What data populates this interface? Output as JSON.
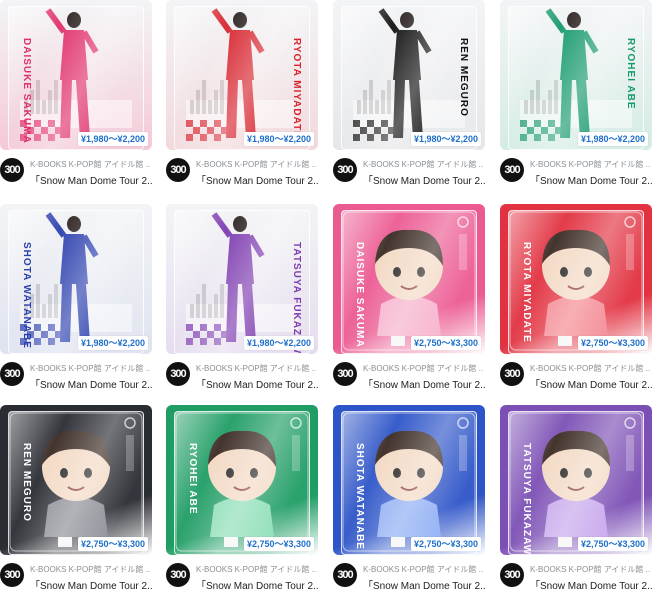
{
  "items": [
    {
      "price": "¥1,980～¥2,200",
      "avatar": "300",
      "shop": "K-BOOKS K-POP館 アイドル館 ...",
      "title": "「Snow Man Dome Tour 2...",
      "name_text": "DAISUKE SAKUMA",
      "bg": "#f4c9d6",
      "accent": "#e0306a",
      "kind": "acrylic"
    },
    {
      "price": "¥1,980～¥2,200",
      "avatar": "300",
      "shop": "K-BOOKS K-POP館 アイドル館 ...",
      "title": "「Snow Man Dome Tour 2...",
      "name_text": "RYOTA MIYADATE",
      "bg": "#f2d9dc",
      "accent": "#d8242f",
      "kind": "acrylic"
    },
    {
      "price": "¥1,980～¥2,200",
      "avatar": "300",
      "shop": "K-BOOKS K-POP館 アイドル館 ...",
      "title": "「Snow Man Dome Tour 2...",
      "name_text": "REN MEGURO",
      "bg": "#e6e7ea",
      "accent": "#111111",
      "kind": "acrylic"
    },
    {
      "price": "¥1,980～¥2,200",
      "avatar": "300",
      "shop": "K-BOOKS K-POP館 アイドル館 ...",
      "title": "「Snow Man Dome Tour 2...",
      "name_text": "RYOHEI ABE",
      "bg": "#d4ece4",
      "accent": "#169a6c",
      "kind": "acrylic"
    },
    {
      "price": "¥1,980～¥2,200",
      "avatar": "300",
      "shop": "K-BOOKS K-POP館 アイドル館 ...",
      "title": "「Snow Man Dome Tour 2...",
      "name_text": "SHOTA WATANABE",
      "bg": "#dfe3f0",
      "accent": "#2b3fae",
      "kind": "acrylic"
    },
    {
      "price": "¥1,980～¥2,200",
      "avatar": "300",
      "shop": "K-BOOKS K-POP館 アイドル館 ...",
      "title": "「Snow Man Dome Tour 2...",
      "name_text": "TATSUYA FUKAZAWA",
      "bg": "#e6ddef",
      "accent": "#7d3bb0",
      "kind": "acrylic"
    },
    {
      "price": "¥2,750～¥3,300",
      "avatar": "300",
      "shop": "K-BOOKS K-POP館 アイドル館 ...",
      "title": "「Snow Man Dome Tour 2...",
      "name_text": "DAISUKE SAKUMA",
      "bg": "#ec5a92",
      "accent": "#f7b2cc",
      "kind": "figure"
    },
    {
      "price": "¥2,750～¥3,300",
      "avatar": "300",
      "shop": "K-BOOKS K-POP館 アイドル館 ...",
      "title": "「Snow Man Dome Tour 2...",
      "name_text": "RYOTA MIYADATE",
      "bg": "#e23140",
      "accent": "#f48a93",
      "kind": "figure"
    },
    {
      "price": "¥2,750～¥3,300",
      "avatar": "300",
      "shop": "K-BOOKS K-POP館 アイドル館 ...",
      "title": "「Snow Man Dome Tour 2...",
      "name_text": "REN MEGURO",
      "bg": "#2a2c33",
      "accent": "#8d9099",
      "kind": "figure"
    },
    {
      "price": "¥2,750～¥3,300",
      "avatar": "300",
      "shop": "K-BOOKS K-POP館 アイドル館 ...",
      "title": "「Snow Man Dome Tour 2...",
      "name_text": "RYOHEI ABE",
      "bg": "#1f9d64",
      "accent": "#8fe0b8",
      "kind": "figure"
    },
    {
      "price": "¥2,750～¥3,300",
      "avatar": "300",
      "shop": "K-BOOKS K-POP館 アイドル館 ...",
      "title": "「Snow Man Dome Tour 2...",
      "name_text": "SHOTA WATANABE",
      "bg": "#2e55c8",
      "accent": "#8fb0f5",
      "kind": "figure"
    },
    {
      "price": "¥2,750～¥3,300",
      "avatar": "300",
      "shop": "K-BOOKS K-POP館 アイドル館 ...",
      "title": "「Snow Man Dome Tour 2...",
      "name_text": "TATSUYA FUKAZAWA",
      "bg": "#7c4fb5",
      "accent": "#c8a8ee",
      "kind": "figure"
    }
  ]
}
